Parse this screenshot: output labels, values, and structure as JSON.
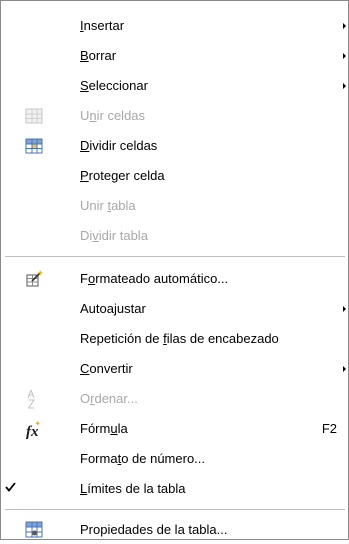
{
  "menu": {
    "items": [
      {
        "pre": "",
        "key": "I",
        "post": "nsertar",
        "submenu": true
      },
      {
        "pre": "",
        "key": "B",
        "post": "orrar",
        "submenu": true
      },
      {
        "pre": "",
        "key": "S",
        "post": "eleccionar",
        "submenu": true
      },
      {
        "pre": "U",
        "key": "n",
        "post": "ir celdas",
        "disabled": true,
        "icon": "merge-cells-icon"
      },
      {
        "pre": "",
        "key": "D",
        "post": "ividir celdas",
        "icon": "split-cells-icon"
      },
      {
        "pre": "",
        "key": "P",
        "post": "roteger celda"
      },
      {
        "pre": "Unir ",
        "key": "t",
        "post": "abla",
        "disabled": true
      },
      {
        "pre": "Di",
        "key": "v",
        "post": "idir tabla",
        "disabled": true
      },
      {
        "pre": "F",
        "key": "o",
        "post": "rmateado automático...",
        "icon": "autoformat-wand-icon"
      },
      {
        "pre": "Autoa",
        "key": "j",
        "post": "ustar",
        "submenu": true
      },
      {
        "pre": "Repetición de ",
        "key": "f",
        "post": "ilas de encabezado"
      },
      {
        "pre": "",
        "key": "C",
        "post": "onvertir",
        "submenu": true
      },
      {
        "pre": "O",
        "key": "r",
        "post": "denar...",
        "disabled": true,
        "icon": "sort-az-icon"
      },
      {
        "pre": "Fórm",
        "key": "u",
        "post": "la",
        "shortcut": "F2",
        "icon": "fx-formula-icon"
      },
      {
        "pre": "Forma",
        "key": "t",
        "post": "o de número..."
      },
      {
        "pre": "",
        "key": "L",
        "post": "ímites de la tabla",
        "checked": true
      },
      {
        "pre": "Propiedades de la tabla...",
        "key": "",
        "post": "",
        "icon": "table-properties-icon"
      }
    ]
  },
  "colors": {
    "disabled": "#a8a8a8",
    "separator": "#bdbdbd",
    "border": "#8a8a8a"
  }
}
